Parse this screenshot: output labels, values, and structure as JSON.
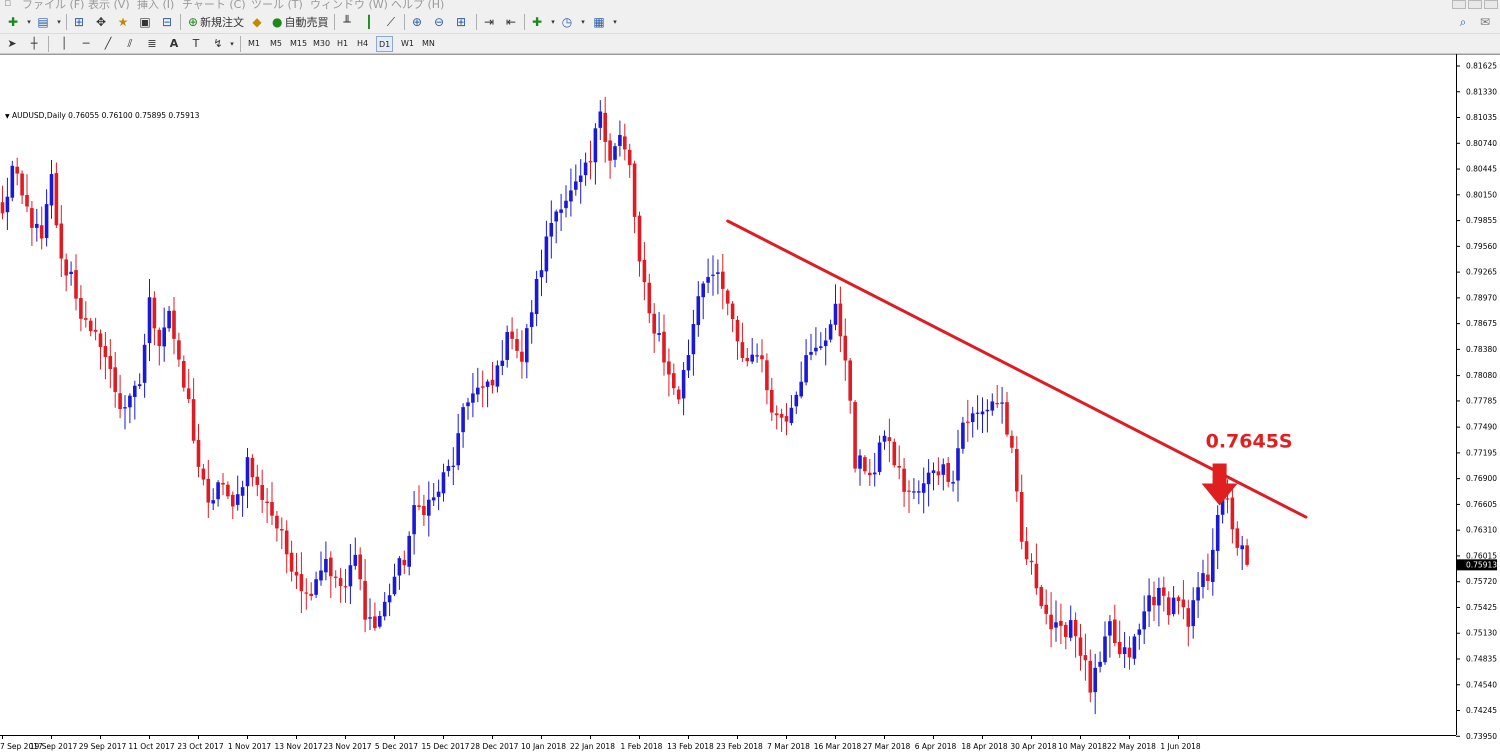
{
  "menu": {
    "items": [
      "ファイル (F)",
      "表示 (V)",
      "挿入 (I)",
      "チャート (C)",
      "ツール (T)",
      "ウィンドウ (W)",
      "ヘルプ (H)"
    ]
  },
  "toolbar": {
    "new_order_label": "新規注文",
    "auto_trade_label": "自動売買"
  },
  "timeframes": [
    "M1",
    "M5",
    "M15",
    "M30",
    "H1",
    "H4",
    "D1",
    "W1",
    "MN"
  ],
  "active_timeframe": "D1",
  "chart": {
    "title": "AUDUSD,Daily  0.76055 0.76100 0.75895 0.75913",
    "current_price": "0.75913",
    "annotation": "0.7645S"
  },
  "colors": {
    "bull": "#1a1ad6",
    "bear": "#dd1c24",
    "trendline": "#dd1c24",
    "annotation": "#e02020",
    "price_tag_bg": "#000000"
  },
  "chart_data": {
    "type": "candlestick",
    "title": "AUDUSD,Daily",
    "ohlc_header": [
      0.76055,
      0.761,
      0.75895,
      0.75913
    ],
    "y_ticks": [
      0.81625,
      0.8133,
      0.81035,
      0.8074,
      0.80445,
      0.8015,
      0.79855,
      0.7956,
      0.79265,
      0.7897,
      0.78675,
      0.7838,
      0.7808,
      0.7779,
      0.7749,
      0.77195,
      0.769,
      0.76605,
      0.7631,
      0.76015,
      0.7572,
      0.75425,
      0.7513,
      0.74835,
      0.7454,
      0.74245,
      0.7395
    ],
    "y_tick_labels": [
      "0.81625",
      "0.81330",
      "0.81035",
      "0.80740",
      "0.80445",
      "0.80150",
      "0.79855",
      "0.79560",
      "0.79265",
      "0.78970",
      "0.78675",
      "0.78380",
      "0.78080",
      "0.77785",
      "0.77490",
      "0.77195",
      "0.76900",
      "0.76605",
      "0.76310",
      "0.76015",
      "0.75720",
      "0.75425",
      "0.75130",
      "0.74835",
      "0.74540",
      "0.74245",
      "0.73950"
    ],
    "ylim": [
      0.7395,
      0.81625
    ],
    "x_labels": [
      "7 Sep 2017",
      "19 Sep 2017",
      "29 Sep 2017",
      "11 Oct 2017",
      "23 Oct 2017",
      "1 Nov 2017",
      "13 Nov 2017",
      "23 Nov 2017",
      "5 Dec 2017",
      "15 Dec 2017",
      "28 Dec 2017",
      "10 Jan 2018",
      "22 Jan 2018",
      "1 Feb 2018",
      "13 Feb 2018",
      "23 Feb 2018",
      "7 Mar 2018",
      "16 Mar 2018",
      "27 Mar 2018",
      "6 Apr 2018",
      "18 Apr 2018",
      "30 Apr 2018",
      "10 May 2018",
      "22 May 2018",
      "1 Jun 2018"
    ],
    "anchors": [
      {
        "i": 0,
        "p": 0.799
      },
      {
        "i": 2,
        "p": 0.8045
      },
      {
        "i": 4,
        "p": 0.801
      },
      {
        "i": 6,
        "p": 0.7985
      },
      {
        "i": 8,
        "p": 0.796
      },
      {
        "i": 10,
        "p": 0.8033
      },
      {
        "i": 12,
        "p": 0.7935
      },
      {
        "i": 14,
        "p": 0.7925
      },
      {
        "i": 16,
        "p": 0.788
      },
      {
        "i": 18,
        "p": 0.785
      },
      {
        "i": 20,
        "p": 0.785
      },
      {
        "i": 22,
        "p": 0.781
      },
      {
        "i": 24,
        "p": 0.7775
      },
      {
        "i": 26,
        "p": 0.7775
      },
      {
        "i": 28,
        "p": 0.78
      },
      {
        "i": 30,
        "p": 0.789
      },
      {
        "i": 32,
        "p": 0.785
      },
      {
        "i": 34,
        "p": 0.7885
      },
      {
        "i": 36,
        "p": 0.7815
      },
      {
        "i": 38,
        "p": 0.7775
      },
      {
        "i": 40,
        "p": 0.7705
      },
      {
        "i": 42,
        "p": 0.7655
      },
      {
        "i": 44,
        "p": 0.7685
      },
      {
        "i": 46,
        "p": 0.7665
      },
      {
        "i": 48,
        "p": 0.767
      },
      {
        "i": 50,
        "p": 0.771
      },
      {
        "i": 52,
        "p": 0.7678
      },
      {
        "i": 54,
        "p": 0.7665
      },
      {
        "i": 56,
        "p": 0.7635
      },
      {
        "i": 58,
        "p": 0.7605
      },
      {
        "i": 60,
        "p": 0.7585
      },
      {
        "i": 62,
        "p": 0.7555
      },
      {
        "i": 64,
        "p": 0.758
      },
      {
        "i": 66,
        "p": 0.76
      },
      {
        "i": 68,
        "p": 0.757
      },
      {
        "i": 70,
        "p": 0.7565
      },
      {
        "i": 72,
        "p": 0.76
      },
      {
        "i": 74,
        "p": 0.754
      },
      {
        "i": 76,
        "p": 0.752
      },
      {
        "i": 78,
        "p": 0.7545
      },
      {
        "i": 80,
        "p": 0.7578
      },
      {
        "i": 82,
        "p": 0.7598
      },
      {
        "i": 84,
        "p": 0.765
      },
      {
        "i": 86,
        "p": 0.766
      },
      {
        "i": 88,
        "p": 0.7665
      },
      {
        "i": 90,
        "p": 0.769
      },
      {
        "i": 92,
        "p": 0.771
      },
      {
        "i": 94,
        "p": 0.776
      },
      {
        "i": 96,
        "p": 0.7795
      },
      {
        "i": 98,
        "p": 0.779
      },
      {
        "i": 100,
        "p": 0.7795
      },
      {
        "i": 102,
        "p": 0.7835
      },
      {
        "i": 104,
        "p": 0.786
      },
      {
        "i": 106,
        "p": 0.7825
      },
      {
        "i": 108,
        "p": 0.7885
      },
      {
        "i": 110,
        "p": 0.7935
      },
      {
        "i": 112,
        "p": 0.7985
      },
      {
        "i": 114,
        "p": 0.801
      },
      {
        "i": 116,
        "p": 0.8015
      },
      {
        "i": 118,
        "p": 0.803
      },
      {
        "i": 120,
        "p": 0.805
      },
      {
        "i": 122,
        "p": 0.8115
      },
      {
        "i": 124,
        "p": 0.806
      },
      {
        "i": 126,
        "p": 0.808
      },
      {
        "i": 128,
        "p": 0.8045
      },
      {
        "i": 130,
        "p": 0.7935
      },
      {
        "i": 132,
        "p": 0.7875
      },
      {
        "i": 134,
        "p": 0.7855
      },
      {
        "i": 136,
        "p": 0.7805
      },
      {
        "i": 138,
        "p": 0.7785
      },
      {
        "i": 140,
        "p": 0.7835
      },
      {
        "i": 142,
        "p": 0.7905
      },
      {
        "i": 144,
        "p": 0.793
      },
      {
        "i": 146,
        "p": 0.7915
      },
      {
        "i": 148,
        "p": 0.789
      },
      {
        "i": 150,
        "p": 0.784
      },
      {
        "i": 152,
        "p": 0.7825
      },
      {
        "i": 154,
        "p": 0.784
      },
      {
        "i": 156,
        "p": 0.7795
      },
      {
        "i": 158,
        "p": 0.776
      },
      {
        "i": 160,
        "p": 0.7765
      },
      {
        "i": 162,
        "p": 0.7795
      },
      {
        "i": 164,
        "p": 0.7825
      },
      {
        "i": 166,
        "p": 0.7835
      },
      {
        "i": 168,
        "p": 0.7855
      },
      {
        "i": 170,
        "p": 0.788
      },
      {
        "i": 172,
        "p": 0.7835
      },
      {
        "i": 174,
        "p": 0.7705
      },
      {
        "i": 176,
        "p": 0.7705
      },
      {
        "i": 178,
        "p": 0.7695
      },
      {
        "i": 180,
        "p": 0.7745
      },
      {
        "i": 182,
        "p": 0.771
      },
      {
        "i": 184,
        "p": 0.768
      },
      {
        "i": 186,
        "p": 0.767
      },
      {
        "i": 188,
        "p": 0.768
      },
      {
        "i": 190,
        "p": 0.7705
      },
      {
        "i": 192,
        "p": 0.77
      },
      {
        "i": 194,
        "p": 0.7695
      },
      {
        "i": 196,
        "p": 0.7755
      },
      {
        "i": 198,
        "p": 0.776
      },
      {
        "i": 200,
        "p": 0.7765
      },
      {
        "i": 202,
        "p": 0.778
      },
      {
        "i": 204,
        "p": 0.7775
      },
      {
        "i": 206,
        "p": 0.7715
      },
      {
        "i": 208,
        "p": 0.7615
      },
      {
        "i": 210,
        "p": 0.7585
      },
      {
        "i": 212,
        "p": 0.7555
      },
      {
        "i": 214,
        "p": 0.752
      },
      {
        "i": 216,
        "p": 0.751
      },
      {
        "i": 218,
        "p": 0.753
      },
      {
        "i": 220,
        "p": 0.7495
      },
      {
        "i": 222,
        "p": 0.745
      },
      {
        "i": 224,
        "p": 0.7475
      },
      {
        "i": 226,
        "p": 0.752
      },
      {
        "i": 228,
        "p": 0.7485
      },
      {
        "i": 230,
        "p": 0.749
      },
      {
        "i": 232,
        "p": 0.7515
      },
      {
        "i": 234,
        "p": 0.7555
      },
      {
        "i": 236,
        "p": 0.7555
      },
      {
        "i": 238,
        "p": 0.7545
      },
      {
        "i": 240,
        "p": 0.7555
      },
      {
        "i": 242,
        "p": 0.7515
      },
      {
        "i": 244,
        "p": 0.7565
      },
      {
        "i": 246,
        "p": 0.758
      },
      {
        "i": 248,
        "p": 0.7655
      },
      {
        "i": 250,
        "p": 0.766
      },
      {
        "i": 252,
        "p": 0.7615
      },
      {
        "i": 254,
        "p": 0.7595
      }
    ],
    "candle_count": 255,
    "last_close": 0.75913,
    "trendline": {
      "from": {
        "i": 148,
        "p": 0.7985
      },
      "to": {
        "i": 266,
        "p": 0.7646
      }
    },
    "annotation": {
      "text": "0.7645S",
      "i": 249,
      "p": 0.7657
    }
  }
}
